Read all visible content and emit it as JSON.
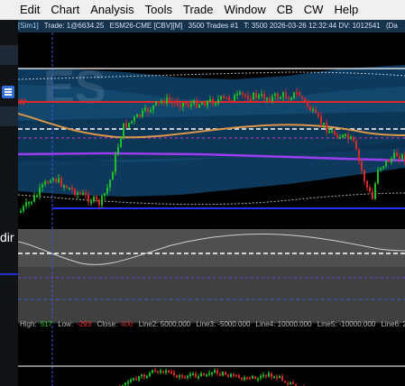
{
  "menu": {
    "items": [
      "Edit",
      "Chart",
      "Analysis",
      "Tools",
      "Trade",
      "Window",
      "CB",
      "CW",
      "Help"
    ]
  },
  "info_bar": {
    "sim": "[Sim1]",
    "trade": "Trade: 1@6634.25",
    "symbol": "ESM26-CME [CBV][M]",
    "trades": "3500 Trades #1",
    "details": "T: 3500 2026-03-26 12:32:44 DV: 1012541",
    "cut": "(Da"
  },
  "chart": {
    "watermark": "ES",
    "marker": "W"
  },
  "indicator": {
    "high_label": "High:",
    "high": "517",
    "low_label": "Low:",
    "low": "-293",
    "close_label": "Close:",
    "close": "400",
    "line2": "Line2: 5000.000",
    "line3": "Line3: -5000.000",
    "line4": "Line4: 10000.000",
    "line5": "Line5: -10000.000",
    "line6": "Line6: 2"
  },
  "left_panel": {
    "partial_text": "dir",
    "hamburger_icon": "hamburger-menu-icon"
  },
  "colors": {
    "bull": "#1fbf2a",
    "bear": "#d42a2a",
    "band": "#0d3a5c",
    "resistance": "#e02828",
    "purple_line": "#9b3df0",
    "support": "#2430ff",
    "moving_average": "#d9954a"
  }
}
